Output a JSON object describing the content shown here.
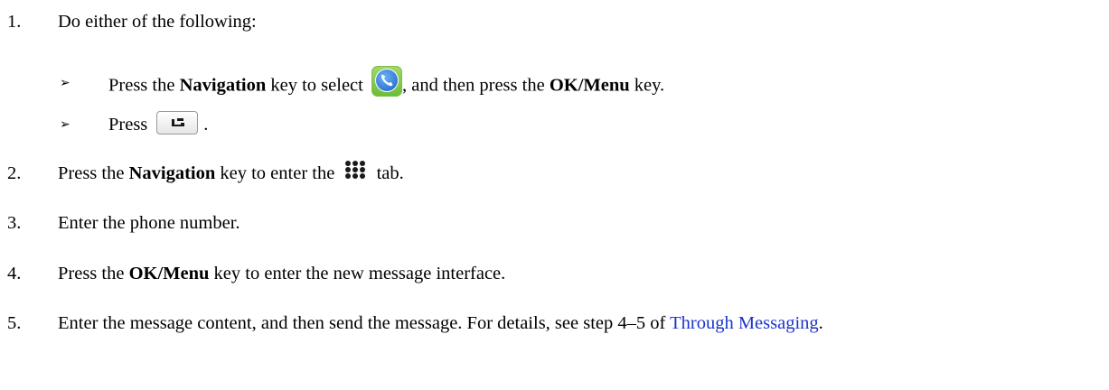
{
  "steps": [
    {
      "number": "1.",
      "text": "Do either of the following:"
    },
    {
      "number": "2.",
      "pre": "Press the ",
      "bold": "Navigation",
      "post1": " key to enter the ",
      "post2": " tab."
    },
    {
      "number": "3.",
      "text": "Enter the phone number."
    },
    {
      "number": "4.",
      "pre": "Press the ",
      "bold": "OK/Menu",
      "post": " key to enter the new message interface."
    },
    {
      "number": "5.",
      "pre": "Enter the message content, and then send the message. For details, see step 4–5 of ",
      "link": "Through Messaging",
      "post": "."
    }
  ],
  "substeps": [
    {
      "bullet": "➢",
      "pre": "Press the ",
      "bold1": "Navigation",
      "mid1": " key to select ",
      "mid2": ", and then press the ",
      "bold2": "OK/Menu",
      "post": " key."
    },
    {
      "bullet": "➢",
      "pre": "Press",
      "post": "."
    }
  ],
  "icons": {
    "phone_app": "phone-app-icon",
    "handset_key": "handset-key-icon",
    "keypad": "dialpad-icon"
  },
  "colors": {
    "text": "#000000",
    "link": "#1a33cc",
    "phone_icon_bg": "#6cbd34",
    "phone_icon_circle": "#2f78d8"
  }
}
